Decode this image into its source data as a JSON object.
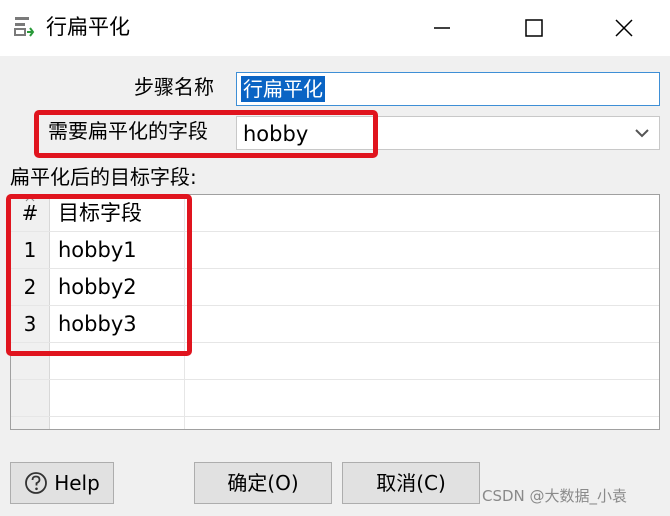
{
  "window": {
    "title": "行扁平化",
    "icon": "row-flatten-icon"
  },
  "form": {
    "step_name_label": "步骤名称",
    "step_name_value": "行扁平化",
    "field_to_flatten_label": "需要扁平化的字段",
    "field_to_flatten_value": "hobby"
  },
  "target_fields": {
    "section_label": "扁平化后的目标字段:",
    "columns": [
      "#",
      "目标字段"
    ],
    "rows": [
      {
        "num": "1",
        "name": "hobby1"
      },
      {
        "num": "2",
        "name": "hobby2"
      },
      {
        "num": "3",
        "name": "hobby3"
      }
    ]
  },
  "buttons": {
    "help": "Help",
    "ok": "确定(O)",
    "cancel": "取消(C)"
  },
  "watermark": "CSDN @大数据_小袁",
  "colors": {
    "highlight_red": "#e0141e",
    "selection_blue": "#0a64c4",
    "input_focus_border": "#3e8fd6"
  }
}
